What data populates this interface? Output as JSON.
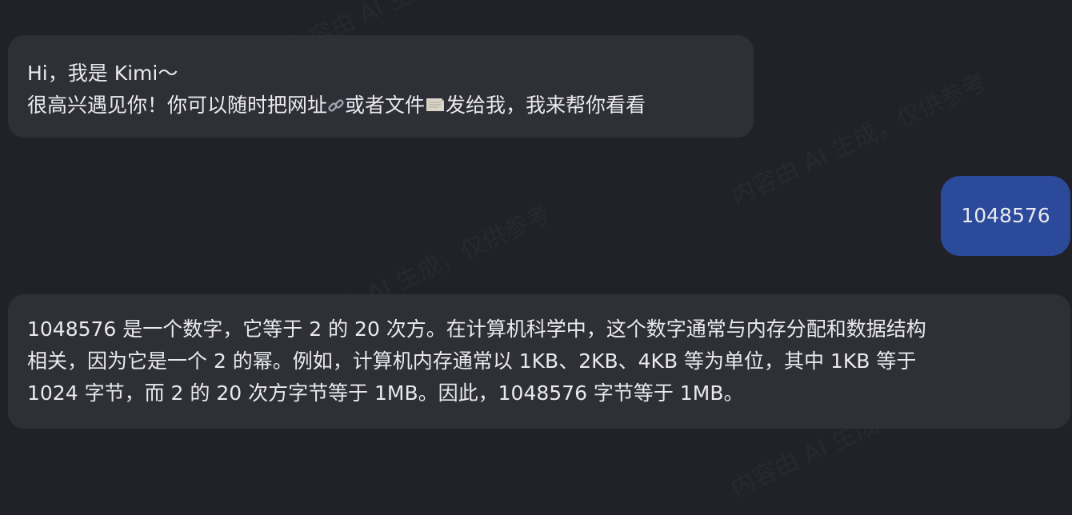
{
  "watermark": "内容由 AI 生成，仅供参考",
  "conversation": {
    "greeting": {
      "line1": "Hi，我是 Kimi～",
      "line2_part1": "很高兴遇见你！你可以随时把网址",
      "link_icon": "link-icon",
      "line2_part2": "或者文件",
      "doc_icon": "document-icon",
      "line2_part3": "发给我，我来帮你看看"
    },
    "user_message": "1048576",
    "answer": {
      "lines": [
        "1048576 是一个数字，它等于 2 的 20 次方。在计算机科学中，这个数字通常与内存分配和数据结构",
        "相关，因为它是一个 2 的幂。例如，计算机内存通常以 1KB、2KB、4KB 等为单位，其中 1KB 等于",
        "1024 字节，而 2 的 20 次方字节等于 1MB。因此，1048576 字节等于 1MB。"
      ]
    }
  },
  "colors": {
    "background": "#212128",
    "assistant_bubble": "#2f2f38",
    "user_bubble": "#2c4a9a",
    "text": "#e9e9ef"
  }
}
